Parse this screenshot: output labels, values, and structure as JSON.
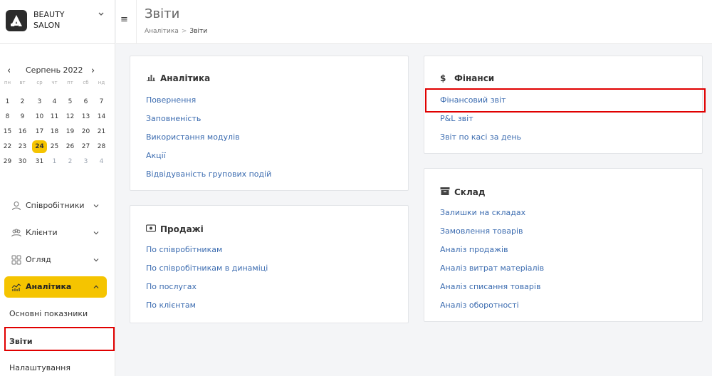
{
  "brand": {
    "line1": "BEAUTY",
    "line2": "SALON"
  },
  "calendar": {
    "title": "Серпень 2022",
    "prev": "‹",
    "next": "›",
    "weekdays": [
      "пн",
      "вт",
      "ср",
      "чт",
      "пт",
      "сб",
      "нд"
    ],
    "weeks": [
      [
        "1",
        "2",
        "3",
        "4",
        "5",
        "6",
        "7"
      ],
      [
        "8",
        "9",
        "10",
        "11",
        "12",
        "13",
        "14"
      ],
      [
        "15",
        "16",
        "17",
        "18",
        "19",
        "20",
        "21"
      ],
      [
        "22",
        "23",
        "24",
        "25",
        "26",
        "27",
        "28"
      ],
      [
        "29",
        "30",
        "31",
        "1",
        "2",
        "3",
        "4"
      ]
    ],
    "today": "24"
  },
  "nav": {
    "employees": "Співробітники",
    "clients": "Клієнти",
    "overview": "Огляд",
    "analytics": "Аналітика",
    "sub_main": "Основні показники",
    "sub_reports": "Звіти",
    "settings": "Налаштування"
  },
  "header": {
    "title": "Звіти",
    "crumb_parent": "Аналітика",
    "crumb_sep": ">",
    "crumb_current": "Звіти"
  },
  "cards": {
    "analytics": {
      "title": "Аналітика",
      "links": [
        "Повернення",
        "Заповненість",
        "Використання модулів",
        "Акції",
        "Відвідуваність групових подій"
      ]
    },
    "sales": {
      "title": "Продажі",
      "links": [
        "По співробітникам",
        "По співробітникам в динаміці",
        "По послугах",
        "По клієнтам"
      ]
    },
    "finance": {
      "title": "Фінанси",
      "links": [
        "Фінансовий звіт",
        "P&L звіт",
        "Звіт по касі за день"
      ]
    },
    "warehouse": {
      "title": "Склад",
      "links": [
        "Залишки на складах",
        "Замовлення товарів",
        "Аналіз продажів",
        "Аналіз витрат матеріалів",
        "Аналіз списання товарів",
        "Аналіз оборотності"
      ]
    }
  },
  "colors": {
    "accent": "#f5c400",
    "link": "#3c6cb0",
    "highlight": "#e00000"
  }
}
